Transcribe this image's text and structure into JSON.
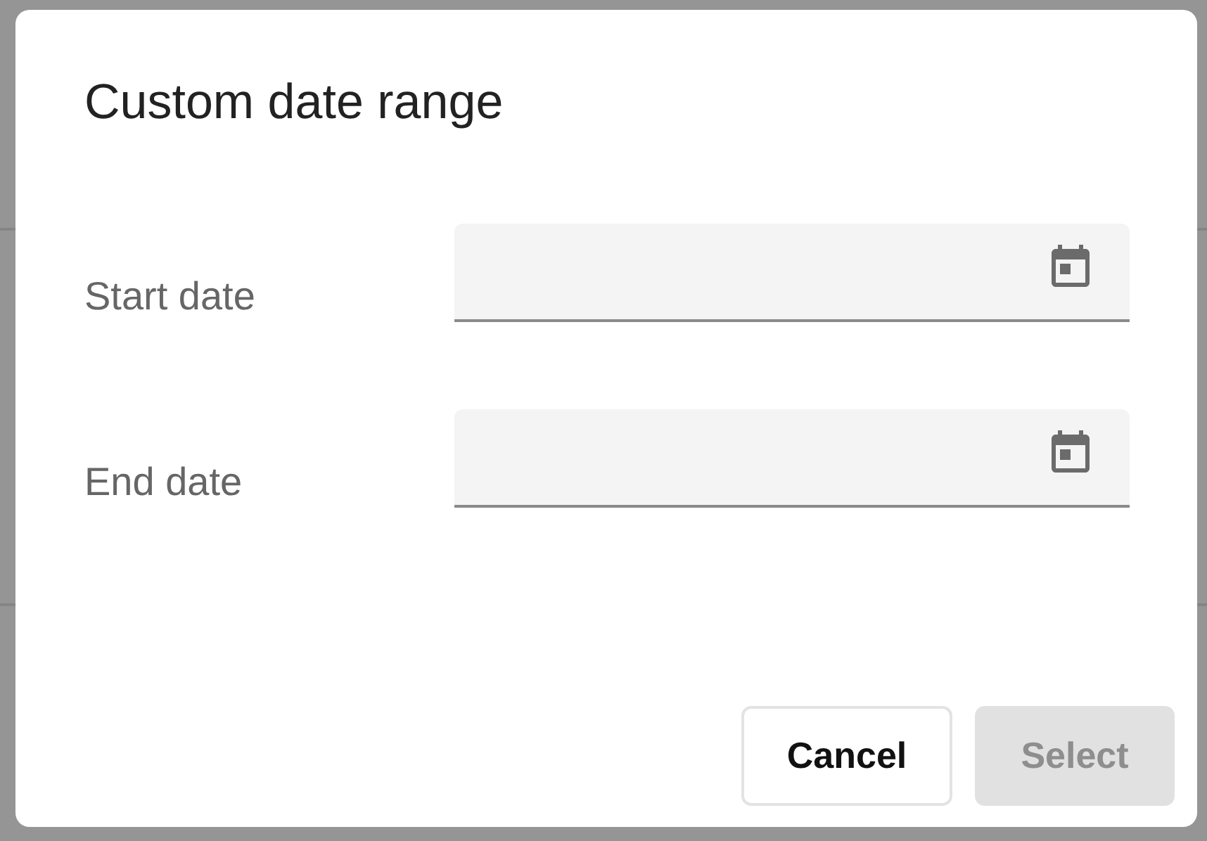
{
  "dialog": {
    "title": "Custom date range",
    "fields": [
      {
        "label": "Start date"
      },
      {
        "label": "End date"
      }
    ],
    "buttons": [
      {
        "label": "Cancel",
        "kind": "outlined",
        "disabled": false
      },
      {
        "label": "Select",
        "kind": "filled",
        "disabled": true
      }
    ]
  }
}
